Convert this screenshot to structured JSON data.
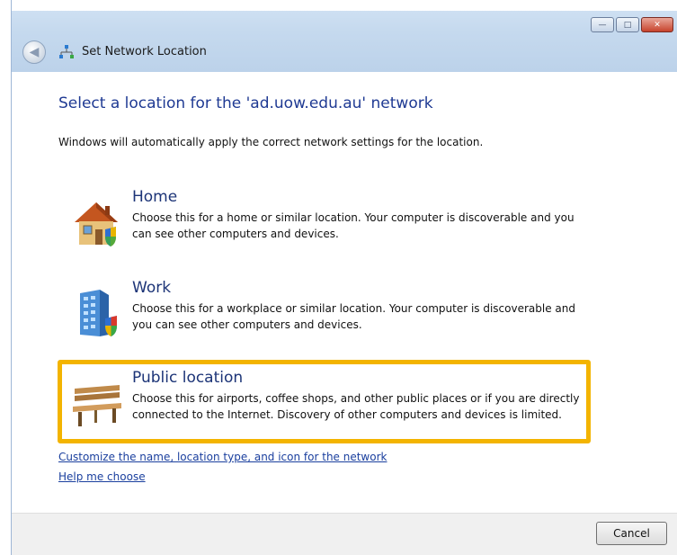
{
  "window": {
    "title": "Set Network Location",
    "caption_buttons": {
      "minimize": "minimize-icon",
      "maximize": "maximize-icon",
      "close": "close-icon"
    }
  },
  "content": {
    "main_instruction": "Select a location for the 'ad.uow.edu.au' network",
    "sub_text": "Windows will automatically apply the correct network settings for the location.",
    "options": [
      {
        "icon": "home-icon",
        "title": "Home",
        "description": "Choose this for a home or similar location. Your computer is discoverable and you can see other computers and devices."
      },
      {
        "icon": "work-icon",
        "title": "Work",
        "description": "Choose this for a workplace or similar location. Your computer is discoverable and you can see other computers and devices."
      },
      {
        "icon": "public-bench-icon",
        "title": "Public location",
        "description": "Choose this for airports, coffee shops, and other public places or if you are directly connected to the Internet. Discovery of other computers and devices is limited."
      }
    ],
    "links": {
      "customize": "Customize the name, location type, and icon for the network",
      "help": "Help me choose"
    }
  },
  "footer": {
    "cancel_label": "Cancel"
  },
  "colors": {
    "highlight": "#f3b400",
    "instruction": "#1f3a93",
    "link": "#1a3f9e"
  }
}
